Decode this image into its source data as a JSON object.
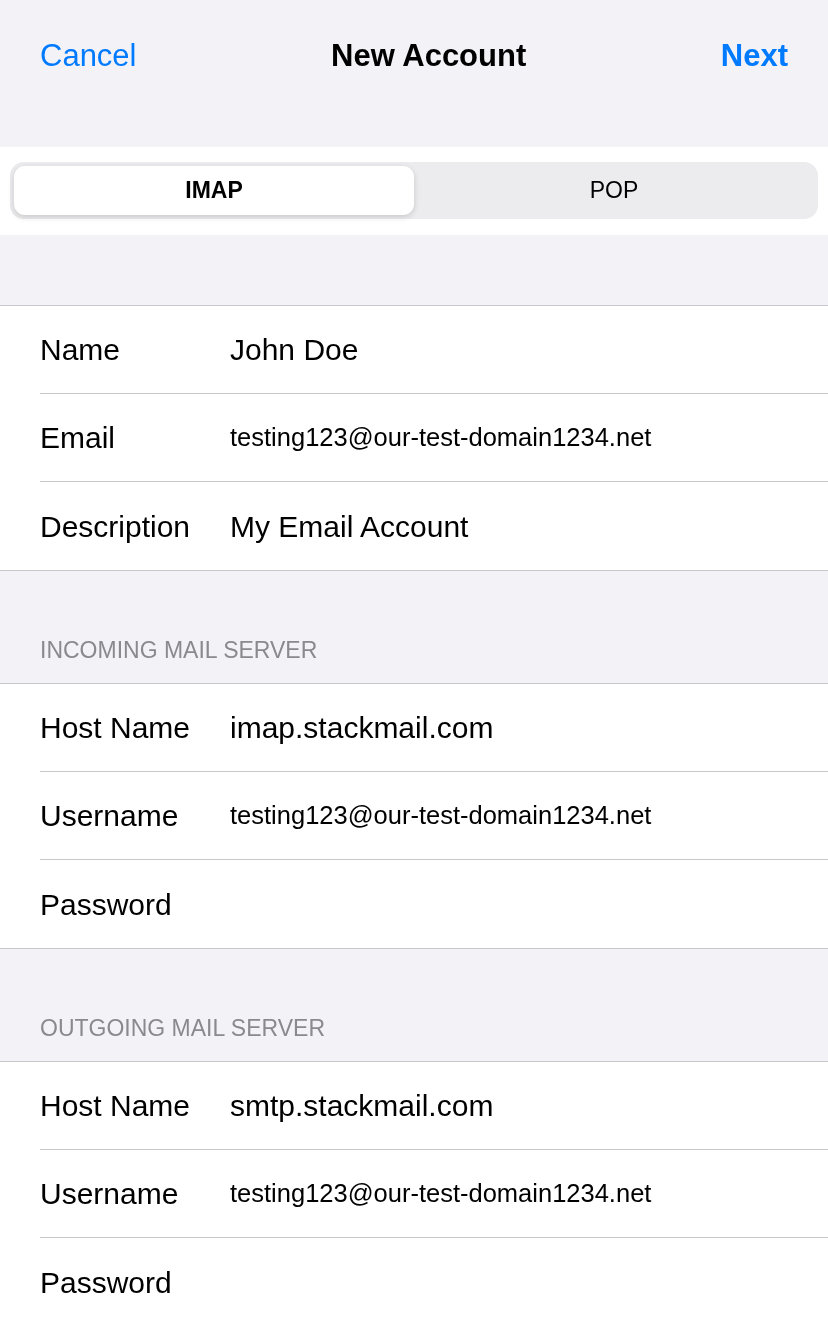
{
  "nav": {
    "cancel": "Cancel",
    "title": "New Account",
    "next": "Next"
  },
  "segments": [
    {
      "label": "IMAP",
      "selected": true
    },
    {
      "label": "POP",
      "selected": false
    }
  ],
  "sections": [
    {
      "rows": [
        {
          "kind": "text",
          "label": "Name",
          "value": "John Doe"
        },
        {
          "kind": "email",
          "label": "Email",
          "value": "testing123@our-test-domain1234.net"
        },
        {
          "kind": "text",
          "label": "Description",
          "value": "My Email Account"
        }
      ]
    },
    {
      "header": "INCOMING MAIL SERVER",
      "rows": [
        {
          "kind": "text",
          "label": "Host Name",
          "value": "imap.stackmail.com"
        },
        {
          "kind": "email",
          "label": "Username",
          "value": "testing123@our-test-domain1234.net"
        },
        {
          "kind": "password",
          "label": "Password"
        }
      ]
    },
    {
      "header": "OUTGOING MAIL SERVER",
      "rows": [
        {
          "kind": "text",
          "label": "Host Name",
          "value": "smtp.stackmail.com"
        },
        {
          "kind": "email",
          "label": "Username",
          "value": "testing123@our-test-domain1234.net"
        },
        {
          "kind": "password",
          "label": "Password"
        }
      ]
    }
  ]
}
